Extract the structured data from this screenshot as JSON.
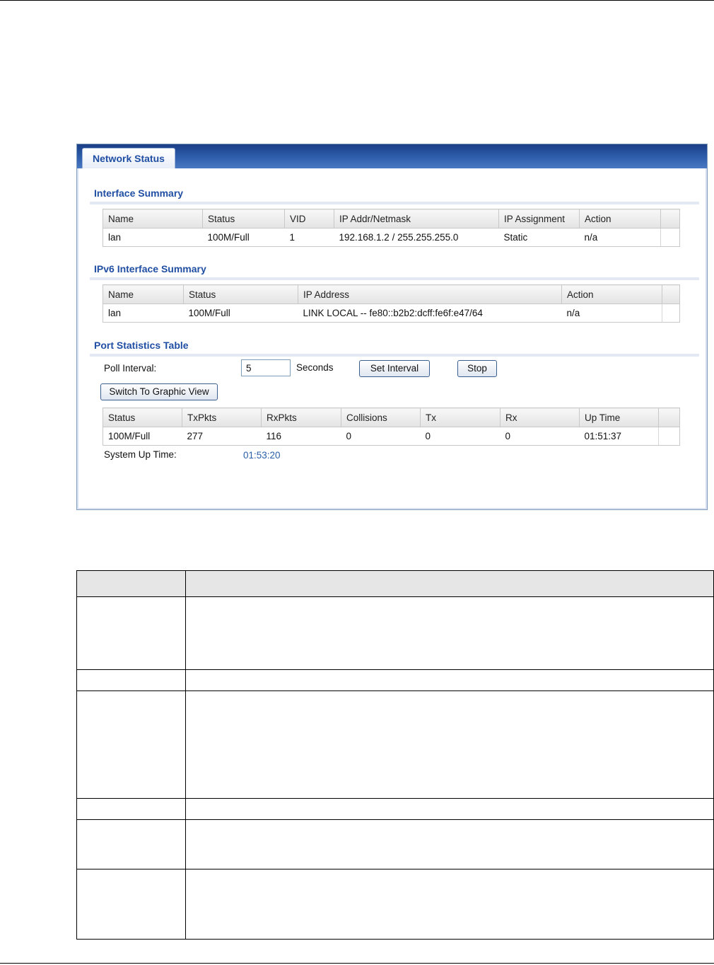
{
  "window": {
    "tab_label": "Network Status"
  },
  "interface_summary": {
    "title": "Interface Summary",
    "columns": [
      "Name",
      "Status",
      "VID",
      "IP Addr/Netmask",
      "IP Assignment",
      "Action"
    ],
    "rows": [
      [
        "lan",
        "100M/Full",
        "1",
        "192.168.1.2 / 255.255.255.0",
        "Static",
        "n/a"
      ]
    ]
  },
  "ipv6_summary": {
    "title": "IPv6 Interface Summary",
    "columns": [
      "Name",
      "Status",
      "IP Address",
      "Action"
    ],
    "rows": [
      [
        "lan",
        "100M/Full",
        "LINK LOCAL -- fe80::b2b2:dcff:fe6f:e47/64",
        "n/a"
      ]
    ]
  },
  "port_statistics": {
    "title": "Port Statistics Table",
    "poll_interval_label": "Poll Interval:",
    "poll_interval_value": "5",
    "seconds_label": "Seconds",
    "set_interval_button": "Set Interval",
    "stop_button": "Stop",
    "switch_view_button": "Switch To Graphic View",
    "columns": [
      "Status",
      "TxPkts",
      "RxPkts",
      "Collisions",
      "Tx",
      "Rx",
      "Up Time"
    ],
    "rows": [
      [
        "100M/Full",
        "277",
        "116",
        "0",
        "0",
        "0",
        "01:51:37"
      ]
    ],
    "system_up_time_label": "System Up Time:",
    "system_up_time_value": "01:53:20"
  }
}
